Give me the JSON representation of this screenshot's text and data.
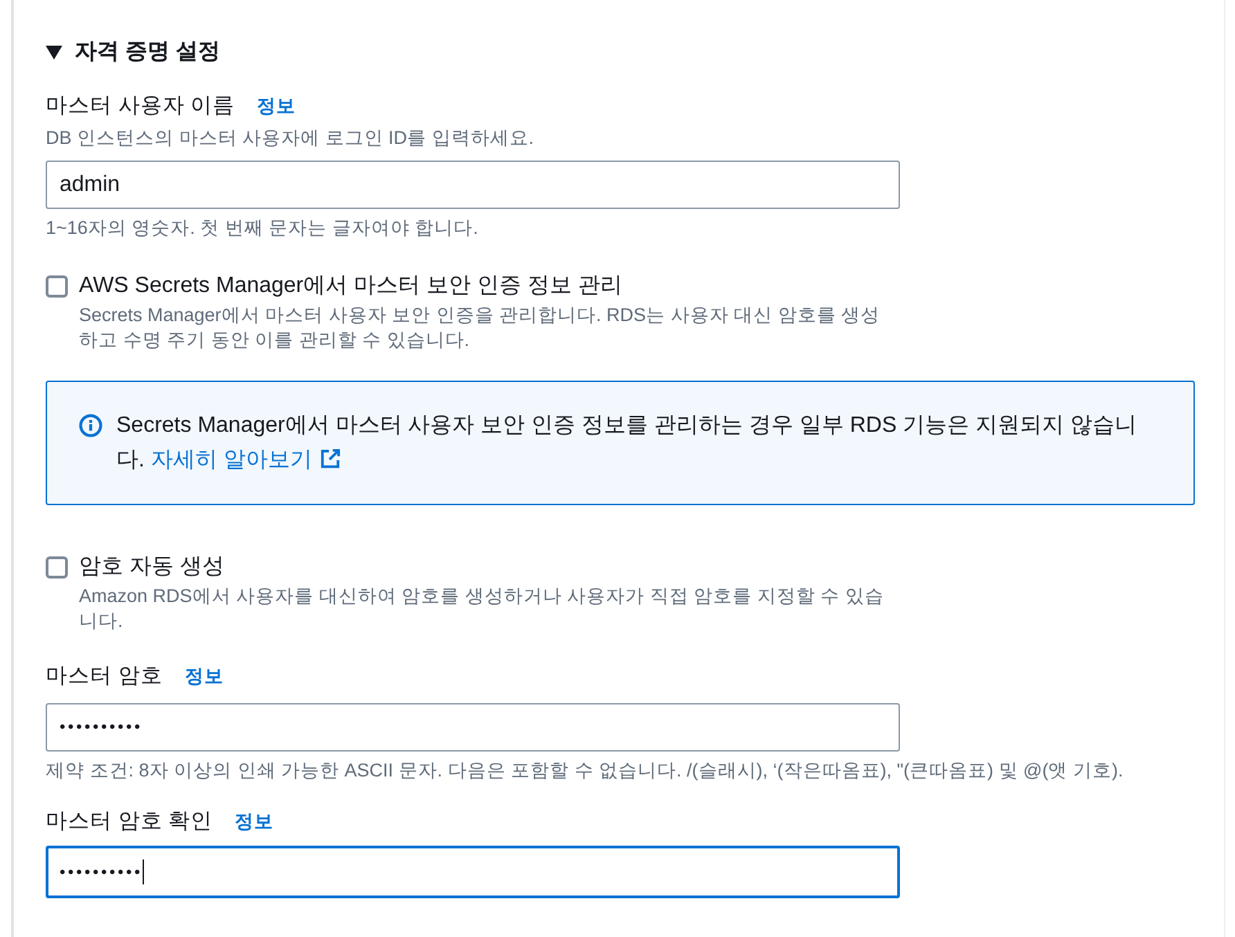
{
  "credentials_section": {
    "title": "자격 증명 설정",
    "expanded": true,
    "master_username": {
      "label": "마스터 사용자 이름",
      "info_link": "정보",
      "description": "DB 인스턴스의 마스터 사용자에 로그인 ID를 입력하세요.",
      "value": "admin",
      "focused": false,
      "constraint": "1~16자의 영숫자. 첫 번째 문자는 글자여야 합니다."
    },
    "manage_in_secrets_manager": {
      "label": "AWS Secrets Manager에서 마스터 보안 인증 정보 관리",
      "checked": false,
      "description": "Secrets Manager에서 마스터 사용자 보안 인증을 관리합니다. RDS는 사용자 대신 암호를 생성하고 수명 주기 동안 이를 관리할 수 있습니다."
    },
    "info_alert": {
      "message": "Secrets Manager에서 마스터 사용자 보안 인증 정보를 관리하는 경우 일부 RDS 기능은 지원되지 않습니다.",
      "link": "자세히 알아보기"
    },
    "auto_generate_password": {
      "label": "암호 자동 생성",
      "checked": false,
      "description": "Amazon RDS에서 사용자를 대신하여 암호를 생성하거나 사용자가 직접 암호를 지정할 수 있습니다."
    },
    "master_password": {
      "label": "마스터 암호",
      "info_link": "정보",
      "value": "••••••••••",
      "focused": false,
      "constraint": "제약 조건: 8자 이상의 인쇄 가능한 ASCII 문자. 다음은 포함할 수 없습니다. /(슬래시), ‘(작은따옴표), \"(큰따옴표) 및 @(앳 기호)."
    },
    "confirm_password": {
      "label": "마스터 암호 확인",
      "info_link": "정보",
      "value": "••••••••••",
      "focused": true
    }
  }
}
